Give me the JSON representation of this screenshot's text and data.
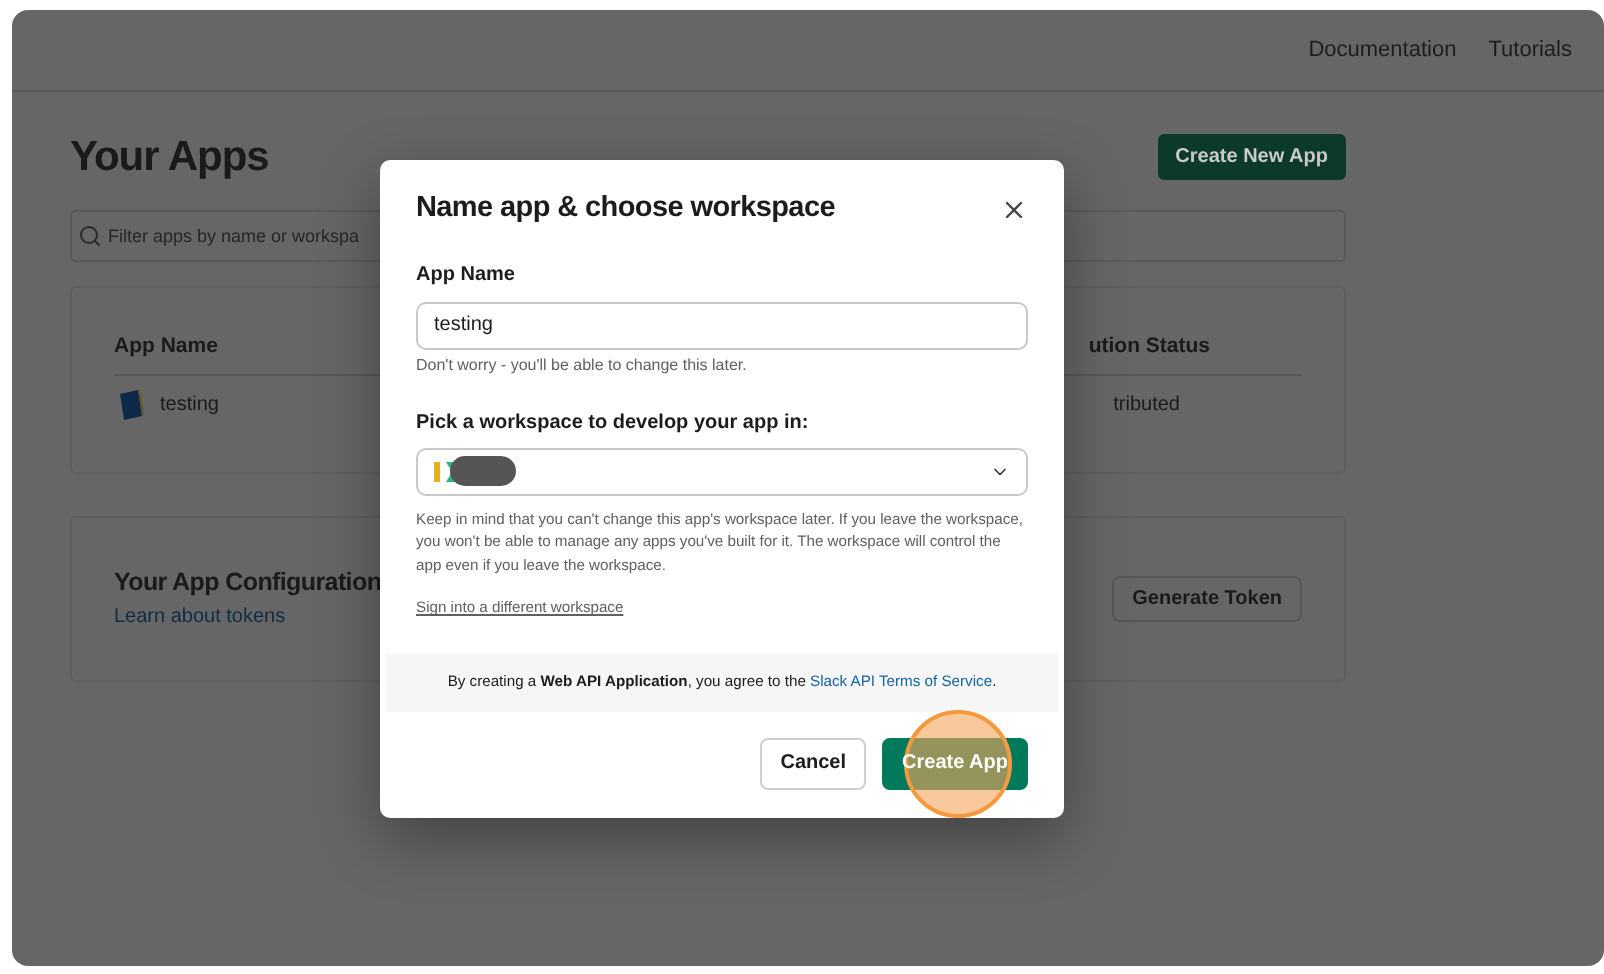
{
  "header": {
    "links": [
      "Documentation",
      "Tutorials"
    ]
  },
  "page": {
    "title": "Your Apps",
    "create_button": "Create New App",
    "filter": {
      "placeholder": "Filter apps by name or workspa"
    },
    "table": {
      "columns": [
        "App Name",
        "ution Status"
      ],
      "rows": [
        {
          "name": "testing",
          "status": "tributed"
        }
      ]
    },
    "config": {
      "title": "Your App Configuration",
      "link": "Learn about tokens",
      "button": "Generate Token"
    }
  },
  "dialog": {
    "title": "Name app & choose workspace",
    "app_name": {
      "label": "App Name",
      "value": "testing",
      "hint": "Don't worry - you'll be able to change this later."
    },
    "workspace": {
      "label": "Pick a workspace to develop your app in:",
      "note": "Keep in mind that you can't change this app's workspace later. If you leave the workspace, you won't be able to manage any apps you've built for it. The workspace will control the app even if you leave the workspace."
    },
    "switch_link": "Sign into a different workspace",
    "terms": {
      "text": "By creating a **Web API Application**, you agree to the ",
      "link": "Slack API Terms of Service",
      "end": "."
    },
    "buttons": [
      {
        "label": "Cancel",
        "kind": "secondary",
        "highlighted": false
      },
      {
        "label": "Create App",
        "kind": "primary",
        "highlighted": true
      }
    ]
  }
}
